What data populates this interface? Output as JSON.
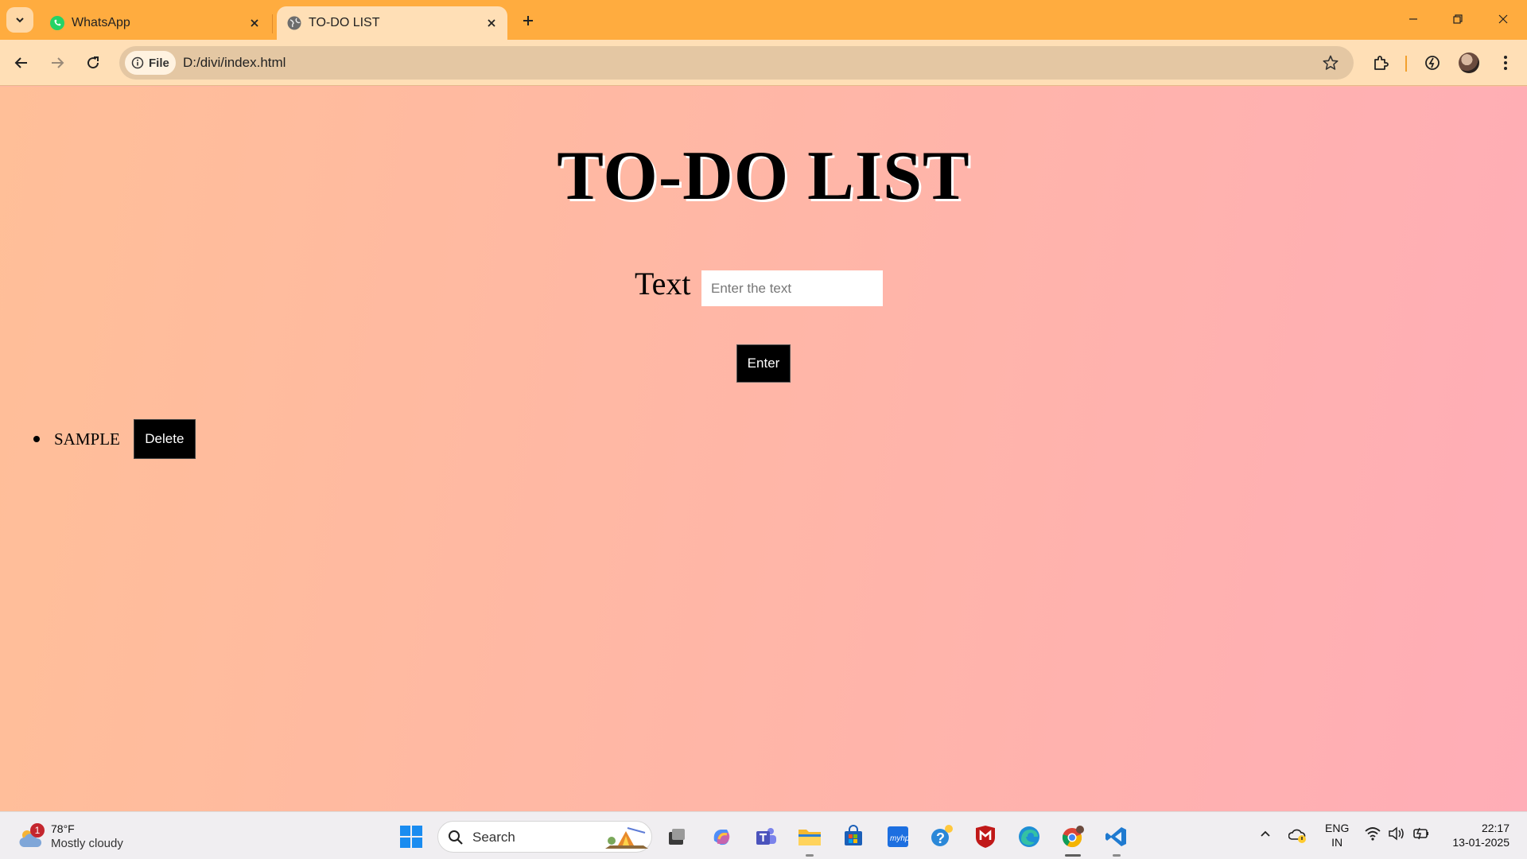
{
  "browser": {
    "tabs": [
      {
        "title": "WhatsApp",
        "favicon": "whatsapp-icon",
        "active": false
      },
      {
        "title": "TO-DO LIST",
        "favicon": "globe-icon",
        "active": true
      }
    ],
    "address": {
      "chip_label": "File",
      "url": "D:/divi/index.html"
    }
  },
  "page": {
    "heading": "TO-DO LIST",
    "input_label": "Text",
    "input_placeholder": "Enter the text",
    "input_value": "",
    "enter_label": "Enter",
    "items": [
      {
        "text": "SAMPLE",
        "delete_label": "Delete"
      }
    ],
    "background_colors": [
      "#ffbf98",
      "#ffadb7"
    ]
  },
  "taskbar": {
    "weather": {
      "badge": "1",
      "temp": "78°F",
      "condition": "Mostly cloudy"
    },
    "search_label": "Search",
    "apps": [
      "task-view",
      "copilot",
      "teams",
      "file-explorer",
      "microsoft-store",
      "myhp",
      "get-help",
      "mcafee",
      "edge",
      "chrome",
      "vscode"
    ],
    "language": {
      "line1": "ENG",
      "line2": "IN"
    },
    "clock": {
      "time": "22:17",
      "date": "13-01-2025"
    }
  }
}
